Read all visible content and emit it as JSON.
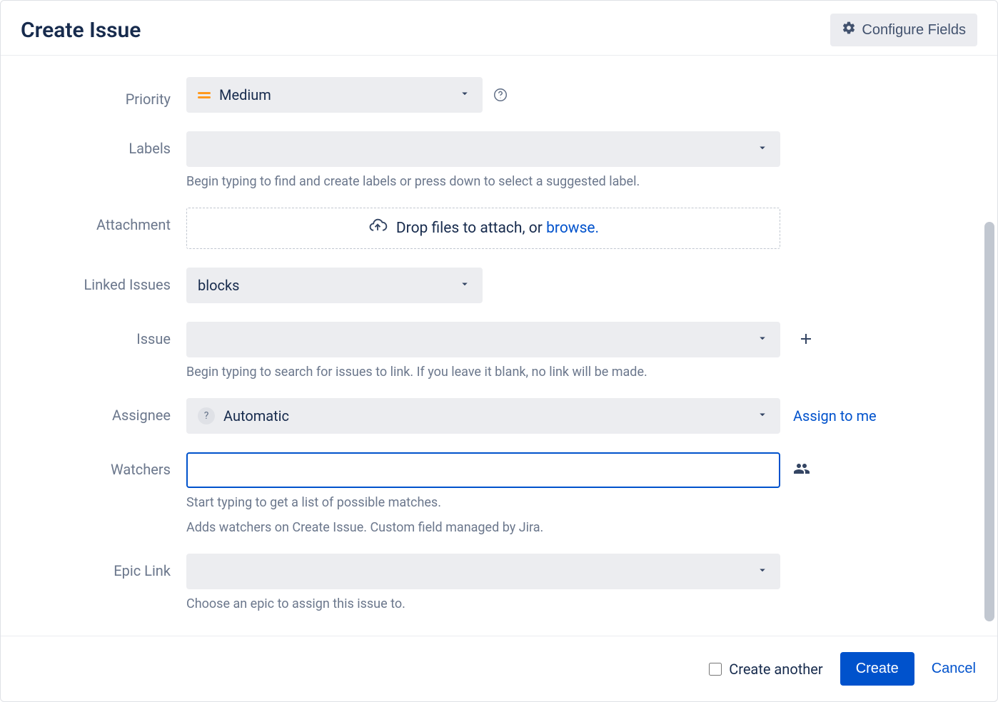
{
  "header": {
    "title": "Create Issue",
    "configure_label": "Configure Fields"
  },
  "fields": {
    "priority": {
      "label": "Priority",
      "value": "Medium"
    },
    "labels": {
      "label": "Labels",
      "hint": "Begin typing to find and create labels or press down to select a suggested label."
    },
    "attachment": {
      "label": "Attachment",
      "drop_text": "Drop files to attach, or ",
      "browse": "browse."
    },
    "linked_issues": {
      "label": "Linked Issues",
      "value": "blocks"
    },
    "issue": {
      "label": "Issue",
      "hint": "Begin typing to search for issues to link. If you leave it blank, no link will be made."
    },
    "assignee": {
      "label": "Assignee",
      "value": "Automatic",
      "assign_me": "Assign to me"
    },
    "watchers": {
      "label": "Watchers",
      "value": "",
      "hint1": "Start typing to get a list of possible matches.",
      "hint2": "Adds watchers on Create Issue. Custom field managed by Jira."
    },
    "epic_link": {
      "label": "Epic Link",
      "hint": "Choose an epic to assign this issue to."
    }
  },
  "footer": {
    "create_another": "Create another",
    "create": "Create",
    "cancel": "Cancel"
  }
}
